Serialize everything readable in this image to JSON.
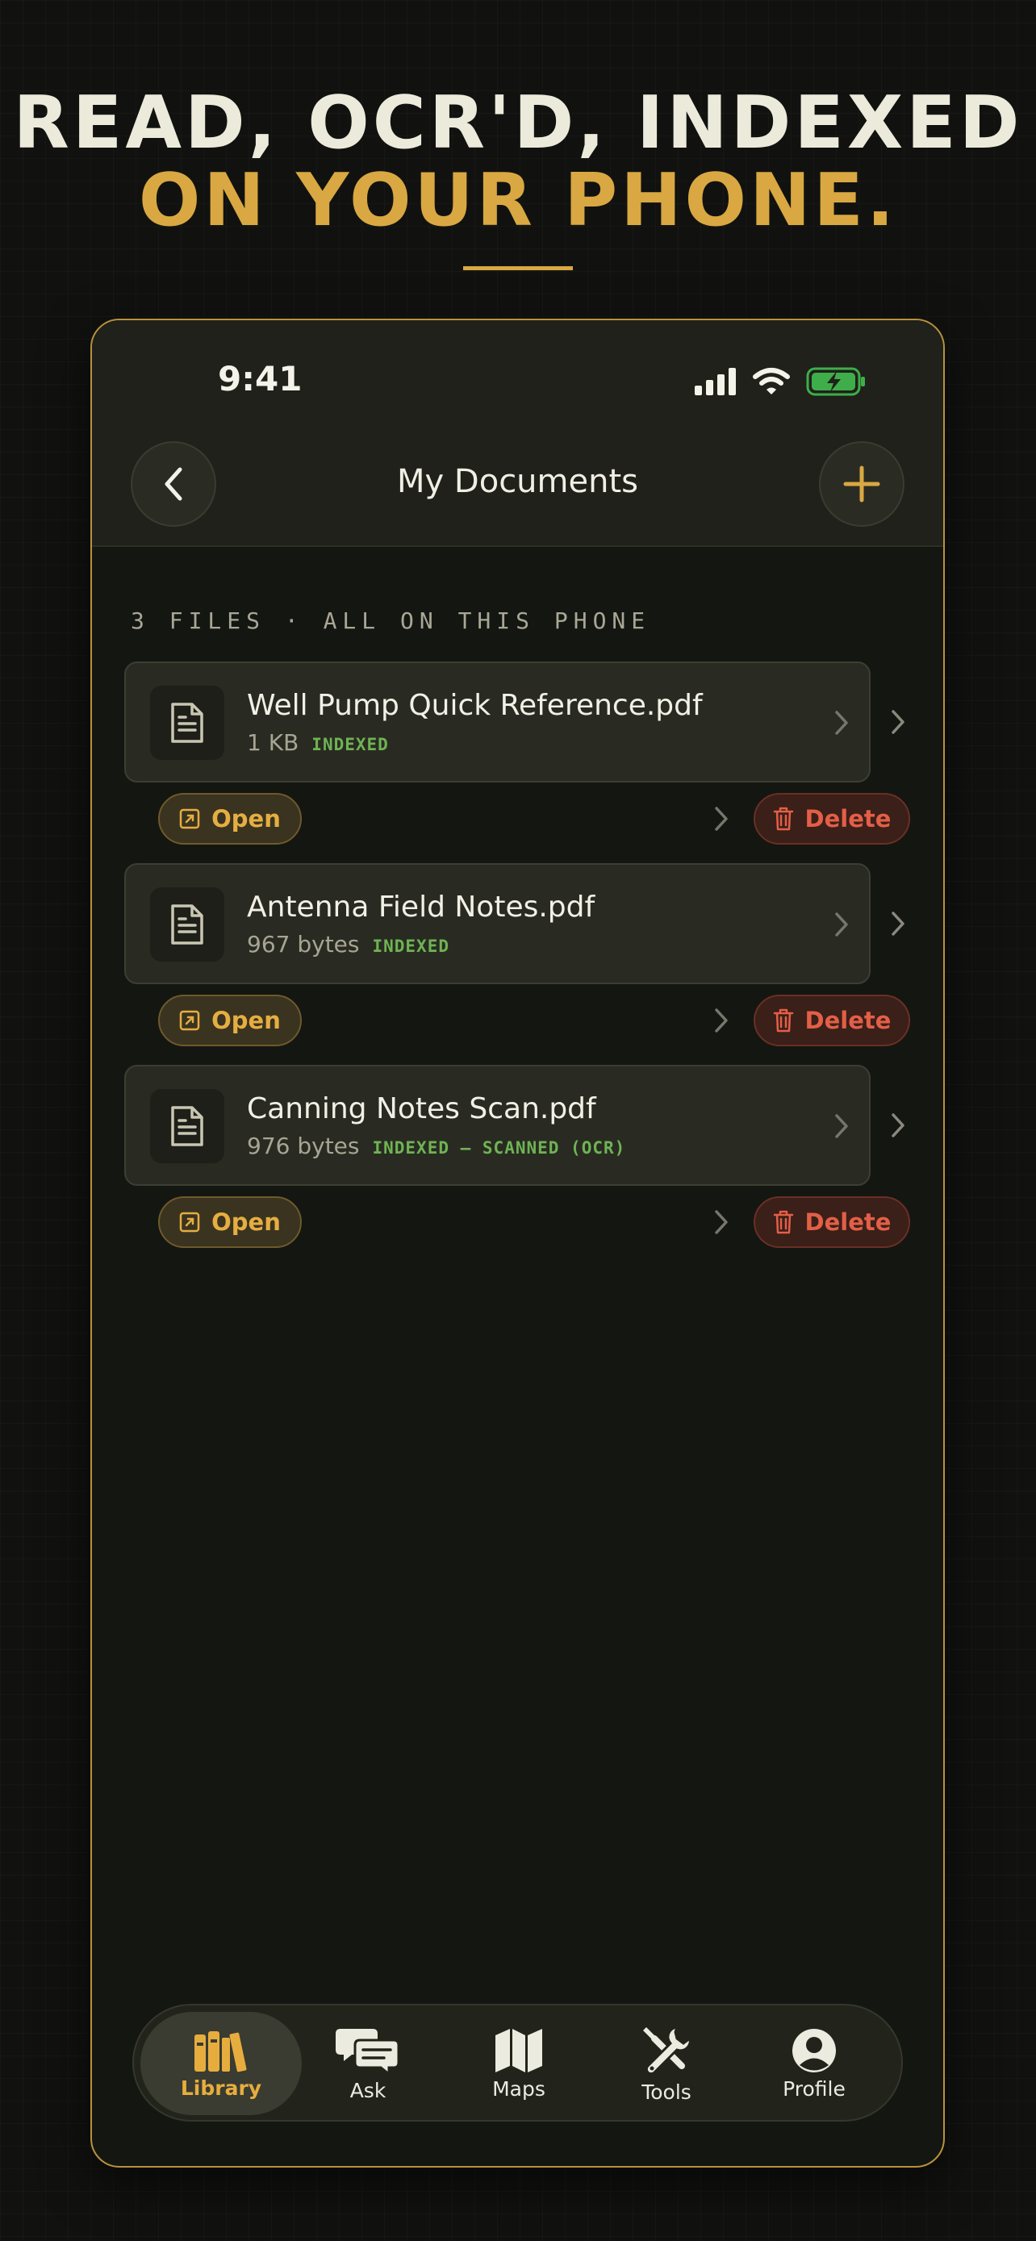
{
  "headline": {
    "line1": "READ, OCR'D, INDEXED",
    "line2": "ON YOUR PHONE."
  },
  "status_bar": {
    "time": "9:41",
    "icons": [
      "signal-icon",
      "wifi-icon",
      "battery-charging-icon"
    ]
  },
  "header": {
    "title": "My Documents",
    "back_icon": "chevron-left-icon",
    "add_icon": "plus-icon"
  },
  "files_summary": "3 FILES · ALL ON THIS PHONE",
  "documents": [
    {
      "name": "Well Pump Quick Reference.pdf",
      "size": "1 KB",
      "status": "INDEXED"
    },
    {
      "name": "Antenna Field Notes.pdf",
      "size": "967 bytes",
      "status": "INDEXED"
    },
    {
      "name": "Canning Notes Scan.pdf",
      "size": "976 bytes",
      "status": "INDEXED — SCANNED (OCR)"
    }
  ],
  "actions": {
    "open_label": "Open",
    "delete_label": "Delete"
  },
  "tabs": [
    {
      "label": "Library",
      "icon": "books-icon",
      "active": true
    },
    {
      "label": "Ask",
      "icon": "chat-bubbles-icon",
      "active": false
    },
    {
      "label": "Maps",
      "icon": "map-icon",
      "active": false
    },
    {
      "label": "Tools",
      "icon": "tools-icon",
      "active": false
    },
    {
      "label": "Profile",
      "icon": "profile-icon",
      "active": false
    }
  ],
  "colors": {
    "accent": "#d9a842",
    "indexed": "#6fb354",
    "delete": "#e35f47",
    "battery": "#3fae4a"
  }
}
